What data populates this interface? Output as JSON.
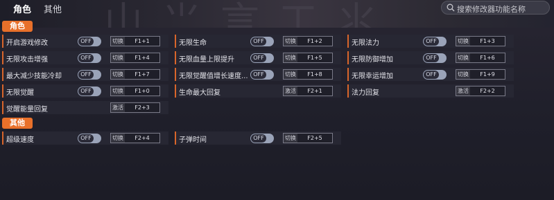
{
  "tabs": [
    "角色",
    "其他"
  ],
  "search": {
    "placeholder": "搜索修改器功能名称"
  },
  "sections": [
    {
      "title": "角色",
      "items": [
        {
          "label": "开启游戏修改",
          "toggle": "OFF",
          "action": "切换",
          "hotkey": "F1+1"
        },
        {
          "label": "无限生命",
          "toggle": "OFF",
          "action": "切换",
          "hotkey": "F1+2"
        },
        {
          "label": "无限法力",
          "toggle": "OFF",
          "action": "切换",
          "hotkey": "F1+3"
        },
        {
          "label": "无限攻击增强",
          "toggle": "OFF",
          "action": "切换",
          "hotkey": "F1+4"
        },
        {
          "label": "无限血量上限提升",
          "toggle": "OFF",
          "action": "切换",
          "hotkey": "F1+5"
        },
        {
          "label": "无限防御增加",
          "toggle": "OFF",
          "action": "切换",
          "hotkey": "F1+6"
        },
        {
          "label": "最大减少技能冷却",
          "toggle": "OFF",
          "action": "切换",
          "hotkey": "F1+7"
        },
        {
          "label": "无限觉醒值增长速度...",
          "toggle": "OFF",
          "action": "切换",
          "hotkey": "F1+8"
        },
        {
          "label": "无限幸运增加",
          "toggle": "OFF",
          "action": "切换",
          "hotkey": "F1+9"
        },
        {
          "label": "无限觉醒",
          "toggle": "OFF",
          "action": "切换",
          "hotkey": "F1+0"
        },
        {
          "label": "生命最大回复",
          "toggle": null,
          "action": "激活",
          "hotkey": "F2+1"
        },
        {
          "label": "法力回复",
          "toggle": null,
          "action": "激活",
          "hotkey": "F2+2"
        },
        {
          "label": "觉醒能量回复",
          "toggle": null,
          "action": "激活",
          "hotkey": "F2+3"
        }
      ]
    },
    {
      "title": "其他",
      "items": [
        {
          "label": "超级速度",
          "toggle": "OFF",
          "action": "切换",
          "hotkey": "F2+4"
        },
        {
          "label": "子弹时间",
          "toggle": "OFF",
          "action": "切换",
          "hotkey": "F2+5"
        }
      ]
    }
  ],
  "colors": {
    "accent": "#e8702a",
    "row_bg": "#272733",
    "toggle_track": "#9aa3b8"
  }
}
